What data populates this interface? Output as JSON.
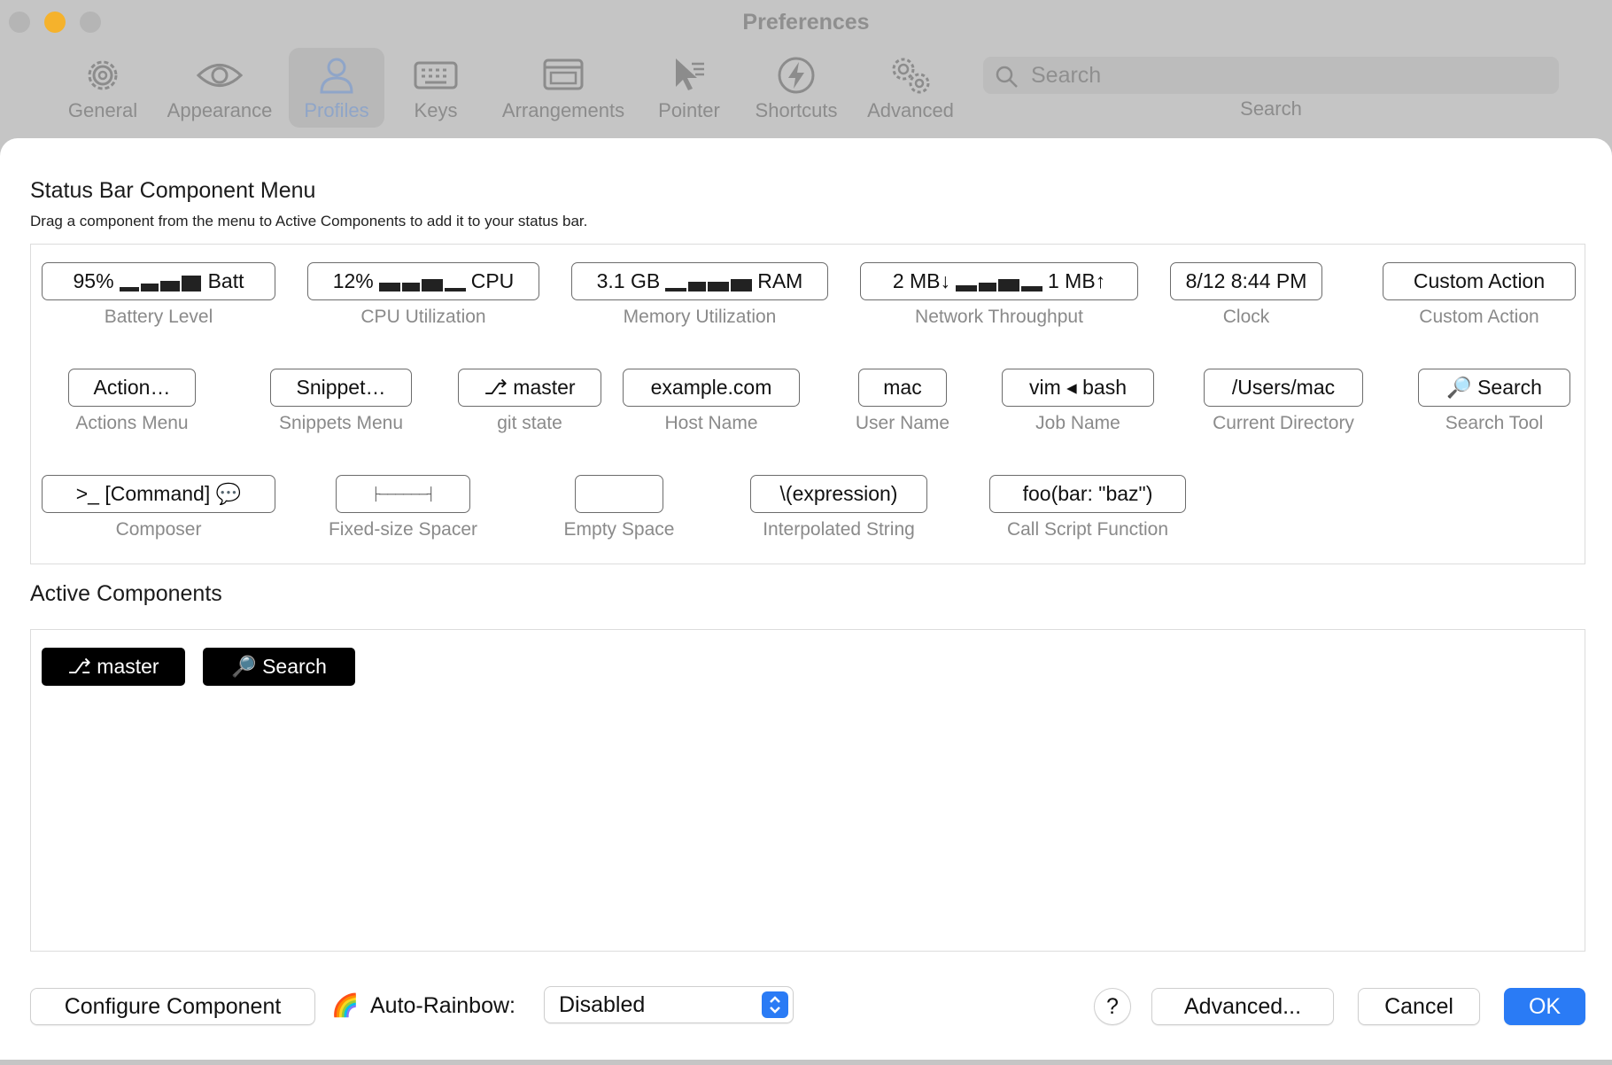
{
  "window": {
    "title": "Preferences"
  },
  "toolbar": {
    "tabs": [
      {
        "label": "General",
        "icon": "gear-icon"
      },
      {
        "label": "Appearance",
        "icon": "eye-icon"
      },
      {
        "label": "Profiles",
        "icon": "person-icon",
        "selected": true
      },
      {
        "label": "Keys",
        "icon": "keyboard-icon"
      },
      {
        "label": "Arrangements",
        "icon": "windows-icon"
      },
      {
        "label": "Pointer",
        "icon": "pointer-icon"
      },
      {
        "label": "Shortcuts",
        "icon": "bolt-icon"
      },
      {
        "label": "Advanced",
        "icon": "gears-icon"
      }
    ],
    "search_placeholder": "Search",
    "search_label": "Search"
  },
  "menu": {
    "title": "Status Bar Component Menu",
    "subtitle": "Drag a component from the menu to Active Components to add it to your status bar.",
    "components": [
      {
        "pre": "95%",
        "post": "Batt",
        "label": "Battery Level"
      },
      {
        "pre": "12%",
        "post": "CPU",
        "label": "CPU Utilization"
      },
      {
        "pre": "3.1 GB",
        "post": "RAM",
        "label": "Memory Utilization"
      },
      {
        "pre": "2 MB↓",
        "post": "1 MB↑",
        "label": "Network Throughput"
      },
      {
        "text": "8/12 8:44 PM",
        "label": "Clock"
      },
      {
        "text": "Custom Action",
        "label": "Custom Action"
      },
      {
        "text": "Action…",
        "label": "Actions Menu"
      },
      {
        "text": "Snippet…",
        "label": "Snippets Menu"
      },
      {
        "text": "⎇ master",
        "label": "git state"
      },
      {
        "text": "example.com",
        "label": "Host Name"
      },
      {
        "text": "mac",
        "label": "User Name"
      },
      {
        "text": "vim ◂ bash",
        "label": "Job Name"
      },
      {
        "text": "/Users/mac",
        "label": "Current Directory"
      },
      {
        "text": "🔎 Search",
        "label": "Search Tool"
      },
      {
        "text": ">_ [Command] 💬",
        "label": "Composer"
      },
      {
        "text": "├──────┤",
        "label": "Fixed-size Spacer"
      },
      {
        "text": "",
        "label": "Empty Space"
      },
      {
        "text": "\\(expression)",
        "label": "Interpolated String"
      },
      {
        "text": "foo(bar: \"baz\")",
        "label": "Call Script Function"
      }
    ]
  },
  "active": {
    "title": "Active Components",
    "items": [
      "⎇ master",
      "🔎 Search"
    ]
  },
  "footer": {
    "configure": "Configure Component",
    "rainbow_emoji": "🌈",
    "rainbow_label": "Auto-Rainbow:",
    "rainbow_value": "Disabled",
    "help": "?",
    "advanced": "Advanced...",
    "cancel": "Cancel",
    "ok": "OK"
  },
  "colors": {
    "accent": "#2a7bf5",
    "close": "#b0b0b0",
    "minimize": "#f5b12a"
  }
}
